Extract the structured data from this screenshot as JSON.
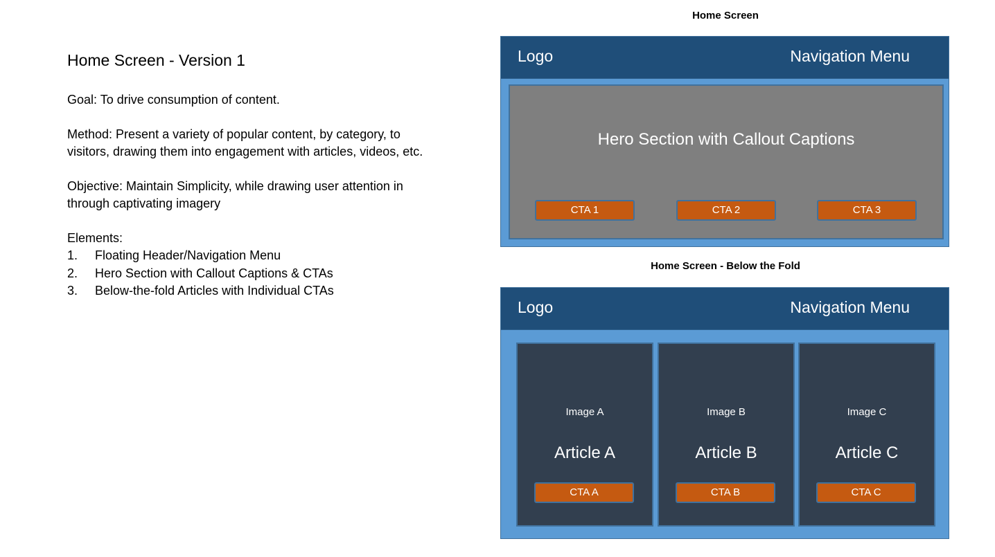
{
  "left": {
    "title": "Home Screen - Version 1",
    "goal": "Goal: To drive consumption of content.",
    "method": "Method: Present a variety of popular content, by category, to visitors, drawing them into engagement with articles, videos, etc.",
    "objective": "Objective: Maintain Simplicity, while drawing user attention in through captivating imagery",
    "elements_heading": "Elements:",
    "elements": [
      {
        "num": "1.",
        "text": "Floating Header/Navigation Menu"
      },
      {
        "num": "2.",
        "text": "Hero Section with Callout Captions & CTAs"
      },
      {
        "num": "3.",
        "text": "Below-the-fold Articles with Individual CTAs"
      }
    ]
  },
  "home_screen": {
    "caption": "Home Screen",
    "logo": "Logo",
    "nav": "Navigation Menu",
    "hero_text": "Hero Section with Callout Captions",
    "ctas": [
      "CTA 1",
      "CTA 2",
      "CTA 3"
    ]
  },
  "below_fold": {
    "caption": "Home Screen - Below the Fold",
    "logo": "Logo",
    "nav": "Navigation Menu",
    "articles": [
      {
        "image": "Image A",
        "title": "Article A",
        "cta": "CTA A"
      },
      {
        "image": "Image B",
        "title": "Article B",
        "cta": "CTA B"
      },
      {
        "image": "Image C",
        "title": "Article C",
        "cta": "CTA C"
      }
    ]
  },
  "colors": {
    "frame_bg": "#5b9bd5",
    "header_bg": "#1f4e79",
    "hero_bg": "#7f7f7f",
    "article_bg": "#323f4f",
    "cta_bg": "#c55a11",
    "border": "#41719c"
  }
}
